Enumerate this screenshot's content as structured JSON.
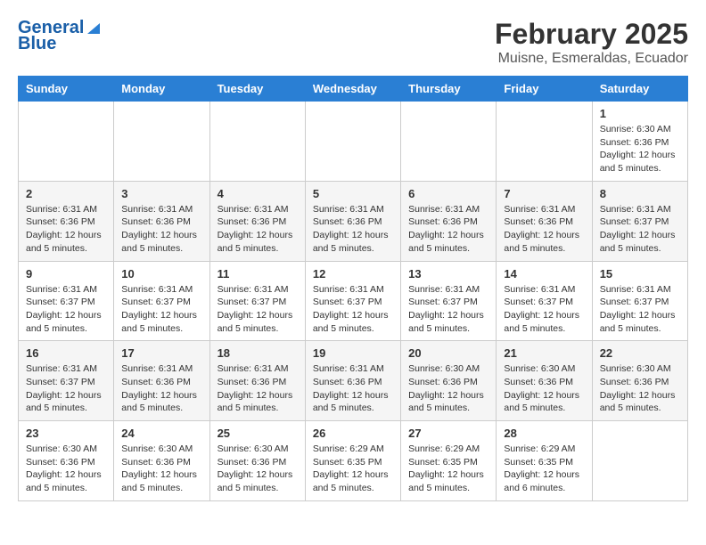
{
  "header": {
    "logo_line1": "General",
    "logo_line2": "Blue",
    "title": "February 2025",
    "subtitle": "Muisne, Esmeraldas, Ecuador"
  },
  "days_of_week": [
    "Sunday",
    "Monday",
    "Tuesday",
    "Wednesday",
    "Thursday",
    "Friday",
    "Saturday"
  ],
  "weeks": [
    [
      {
        "num": "",
        "info": ""
      },
      {
        "num": "",
        "info": ""
      },
      {
        "num": "",
        "info": ""
      },
      {
        "num": "",
        "info": ""
      },
      {
        "num": "",
        "info": ""
      },
      {
        "num": "",
        "info": ""
      },
      {
        "num": "1",
        "info": "Sunrise: 6:30 AM\nSunset: 6:36 PM\nDaylight: 12 hours\nand 5 minutes."
      }
    ],
    [
      {
        "num": "2",
        "info": "Sunrise: 6:31 AM\nSunset: 6:36 PM\nDaylight: 12 hours\nand 5 minutes."
      },
      {
        "num": "3",
        "info": "Sunrise: 6:31 AM\nSunset: 6:36 PM\nDaylight: 12 hours\nand 5 minutes."
      },
      {
        "num": "4",
        "info": "Sunrise: 6:31 AM\nSunset: 6:36 PM\nDaylight: 12 hours\nand 5 minutes."
      },
      {
        "num": "5",
        "info": "Sunrise: 6:31 AM\nSunset: 6:36 PM\nDaylight: 12 hours\nand 5 minutes."
      },
      {
        "num": "6",
        "info": "Sunrise: 6:31 AM\nSunset: 6:36 PM\nDaylight: 12 hours\nand 5 minutes."
      },
      {
        "num": "7",
        "info": "Sunrise: 6:31 AM\nSunset: 6:36 PM\nDaylight: 12 hours\nand 5 minutes."
      },
      {
        "num": "8",
        "info": "Sunrise: 6:31 AM\nSunset: 6:37 PM\nDaylight: 12 hours\nand 5 minutes."
      }
    ],
    [
      {
        "num": "9",
        "info": "Sunrise: 6:31 AM\nSunset: 6:37 PM\nDaylight: 12 hours\nand 5 minutes."
      },
      {
        "num": "10",
        "info": "Sunrise: 6:31 AM\nSunset: 6:37 PM\nDaylight: 12 hours\nand 5 minutes."
      },
      {
        "num": "11",
        "info": "Sunrise: 6:31 AM\nSunset: 6:37 PM\nDaylight: 12 hours\nand 5 minutes."
      },
      {
        "num": "12",
        "info": "Sunrise: 6:31 AM\nSunset: 6:37 PM\nDaylight: 12 hours\nand 5 minutes."
      },
      {
        "num": "13",
        "info": "Sunrise: 6:31 AM\nSunset: 6:37 PM\nDaylight: 12 hours\nand 5 minutes."
      },
      {
        "num": "14",
        "info": "Sunrise: 6:31 AM\nSunset: 6:37 PM\nDaylight: 12 hours\nand 5 minutes."
      },
      {
        "num": "15",
        "info": "Sunrise: 6:31 AM\nSunset: 6:37 PM\nDaylight: 12 hours\nand 5 minutes."
      }
    ],
    [
      {
        "num": "16",
        "info": "Sunrise: 6:31 AM\nSunset: 6:37 PM\nDaylight: 12 hours\nand 5 minutes."
      },
      {
        "num": "17",
        "info": "Sunrise: 6:31 AM\nSunset: 6:36 PM\nDaylight: 12 hours\nand 5 minutes."
      },
      {
        "num": "18",
        "info": "Sunrise: 6:31 AM\nSunset: 6:36 PM\nDaylight: 12 hours\nand 5 minutes."
      },
      {
        "num": "19",
        "info": "Sunrise: 6:31 AM\nSunset: 6:36 PM\nDaylight: 12 hours\nand 5 minutes."
      },
      {
        "num": "20",
        "info": "Sunrise: 6:30 AM\nSunset: 6:36 PM\nDaylight: 12 hours\nand 5 minutes."
      },
      {
        "num": "21",
        "info": "Sunrise: 6:30 AM\nSunset: 6:36 PM\nDaylight: 12 hours\nand 5 minutes."
      },
      {
        "num": "22",
        "info": "Sunrise: 6:30 AM\nSunset: 6:36 PM\nDaylight: 12 hours\nand 5 minutes."
      }
    ],
    [
      {
        "num": "23",
        "info": "Sunrise: 6:30 AM\nSunset: 6:36 PM\nDaylight: 12 hours\nand 5 minutes."
      },
      {
        "num": "24",
        "info": "Sunrise: 6:30 AM\nSunset: 6:36 PM\nDaylight: 12 hours\nand 5 minutes."
      },
      {
        "num": "25",
        "info": "Sunrise: 6:30 AM\nSunset: 6:36 PM\nDaylight: 12 hours\nand 5 minutes."
      },
      {
        "num": "26",
        "info": "Sunrise: 6:29 AM\nSunset: 6:35 PM\nDaylight: 12 hours\nand 5 minutes."
      },
      {
        "num": "27",
        "info": "Sunrise: 6:29 AM\nSunset: 6:35 PM\nDaylight: 12 hours\nand 5 minutes."
      },
      {
        "num": "28",
        "info": "Sunrise: 6:29 AM\nSunset: 6:35 PM\nDaylight: 12 hours\nand 6 minutes."
      },
      {
        "num": "",
        "info": ""
      }
    ]
  ]
}
